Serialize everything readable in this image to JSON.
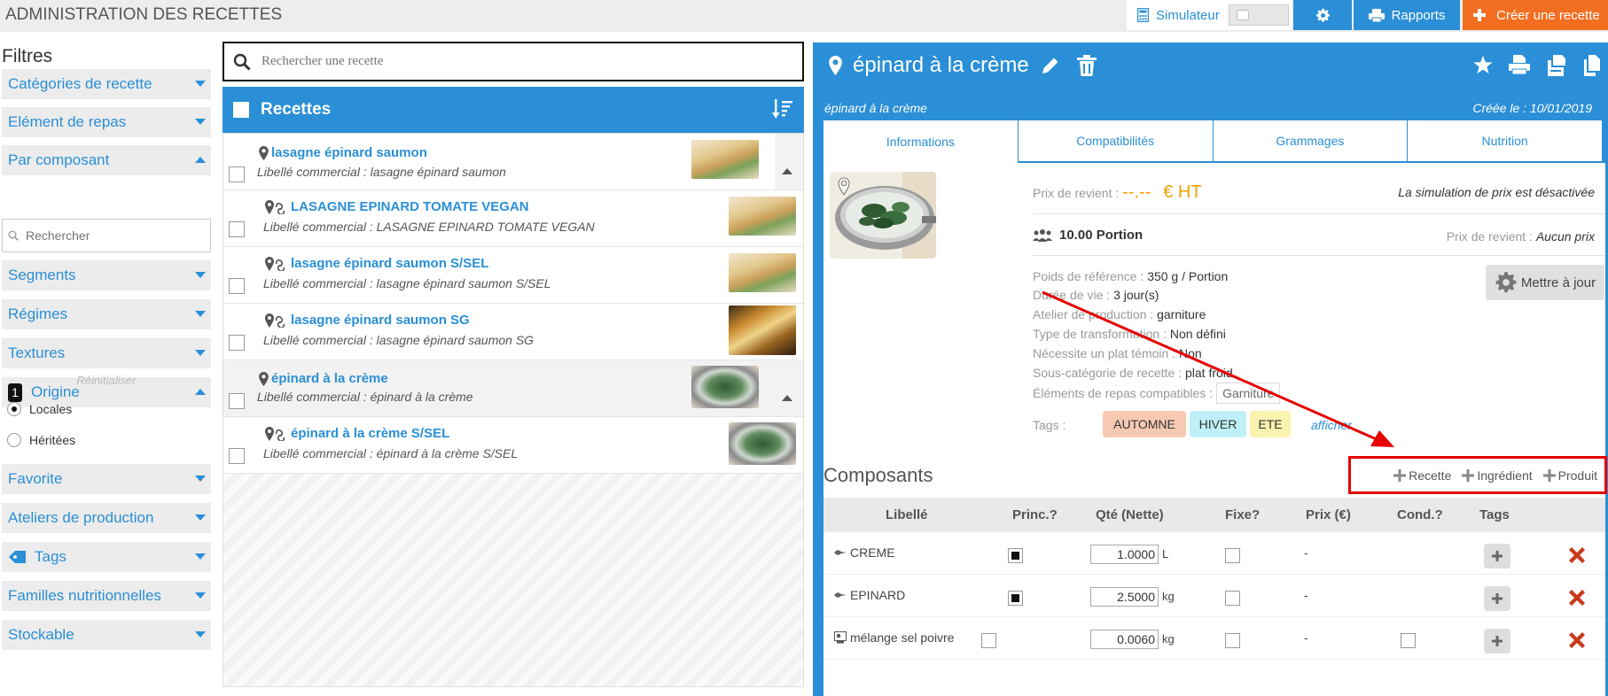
{
  "app": {
    "title": "ADMINISTRATION DES RECETTES"
  },
  "topbar": {
    "simulator_label": "Simulateur",
    "reports_label": "Rapports",
    "create_label": "Créer une recette"
  },
  "filters": {
    "title": "Filtres",
    "categories": "Catégories de recette",
    "meal_element": "Elément de repas",
    "by_component": "Par composant",
    "search_placeholder": "Rechercher",
    "segments": "Segments",
    "diets": "Régimes",
    "textures": "Textures",
    "origin_count": "1",
    "origin": "Origine",
    "reset": "Réinitialiser",
    "local": "Locales",
    "inherited": "Héritées",
    "favorite": "Favorite",
    "workshops": "Ateliers de production",
    "tags": "Tags",
    "nutrition_families": "Familles nutritionnelles",
    "storable": "Stockable"
  },
  "search": {
    "placeholder": "Rechercher une recette"
  },
  "list": {
    "title": "Recettes",
    "items": [
      {
        "name": "lasagne épinard saumon",
        "sub": "Libellé commercial : lasagne épinard saumon"
      },
      {
        "name": "LASAGNE EPINARD TOMATE VEGAN",
        "sub": "Libellé commercial : LASAGNE EPINARD TOMATE VEGAN"
      },
      {
        "name": "lasagne épinard saumon S/SEL",
        "sub": "Libellé commercial : lasagne épinard saumon S/SEL"
      },
      {
        "name": "lasagne épinard saumon SG",
        "sub": "Libellé commercial : lasagne épinard saumon SG"
      },
      {
        "name": "épinard à la crème",
        "sub": "Libellé commercial : épinard à la crème"
      },
      {
        "name": "épinard à la crème S/SEL",
        "sub": "Libellé commercial : épinard à la crème S/SEL"
      }
    ]
  },
  "detail": {
    "title": "épinard à la crème",
    "subtitle": "épinard à la crème",
    "created": "Créée le : 10/01/2019",
    "tabs": [
      "Informations",
      "Compatibilités",
      "Grammages",
      "Nutrition"
    ],
    "cost_label": "Prix de revient :",
    "cost_value": "--.--",
    "cost_unit": "€ HT",
    "simulation_off": "La simulation de prix est désactivée",
    "portion": "10.00 Portion",
    "cost_label2": "Prix de revient :",
    "cost_none": "Aucun prix",
    "update_button": "Mettre à jour",
    "ref_weight_label": "Poids de référence :",
    "ref_weight_value": "350 g / Portion",
    "shelf_life_label": "Durée de vie :",
    "shelf_life_value": "3 jour(s)",
    "workshop_label": "Atelier de production :",
    "workshop_value": "garniture",
    "transform_label": "Type de transformation :",
    "transform_value": "Non défini",
    "witness_label": "Nécessite un plat témoin :",
    "witness_value": "Non",
    "subcat_label": "Sous-catégorie de recette :",
    "subcat_value": "plat froid",
    "compat_label": "Éléments de repas compatibles :",
    "compat_value": "Garniture",
    "tags_label": "Tags :",
    "tags": [
      {
        "label": "AUTOMNE",
        "color": "#f7c9b3"
      },
      {
        "label": "HIVER",
        "color": "#bff0f7"
      },
      {
        "label": "ETE",
        "color": "#fbf3b0"
      }
    ],
    "show_link": "afficher",
    "components_title": "Composants",
    "add_recipe": "Recette",
    "add_ingredient": "Ingrédient",
    "add_product": "Produit",
    "table_headers": [
      "Libellé",
      "Princ.?",
      "Qté (Nette)",
      "Fixe?",
      "Prix (€)",
      "Cond.?",
      "Tags"
    ],
    "rows": [
      {
        "label": "CREME",
        "qty": "1.0000",
        "unit": "L",
        "price": "-"
      },
      {
        "label": "EPINARD",
        "qty": "2.5000",
        "unit": "kg",
        "price": "-"
      },
      {
        "label": "mélange sel poivre",
        "qty": "0.0060",
        "unit": "kg",
        "price": "-"
      }
    ]
  },
  "colors": {
    "accent": "#2a8fd6",
    "create": "#f26f21",
    "highlight": "#e60000"
  }
}
